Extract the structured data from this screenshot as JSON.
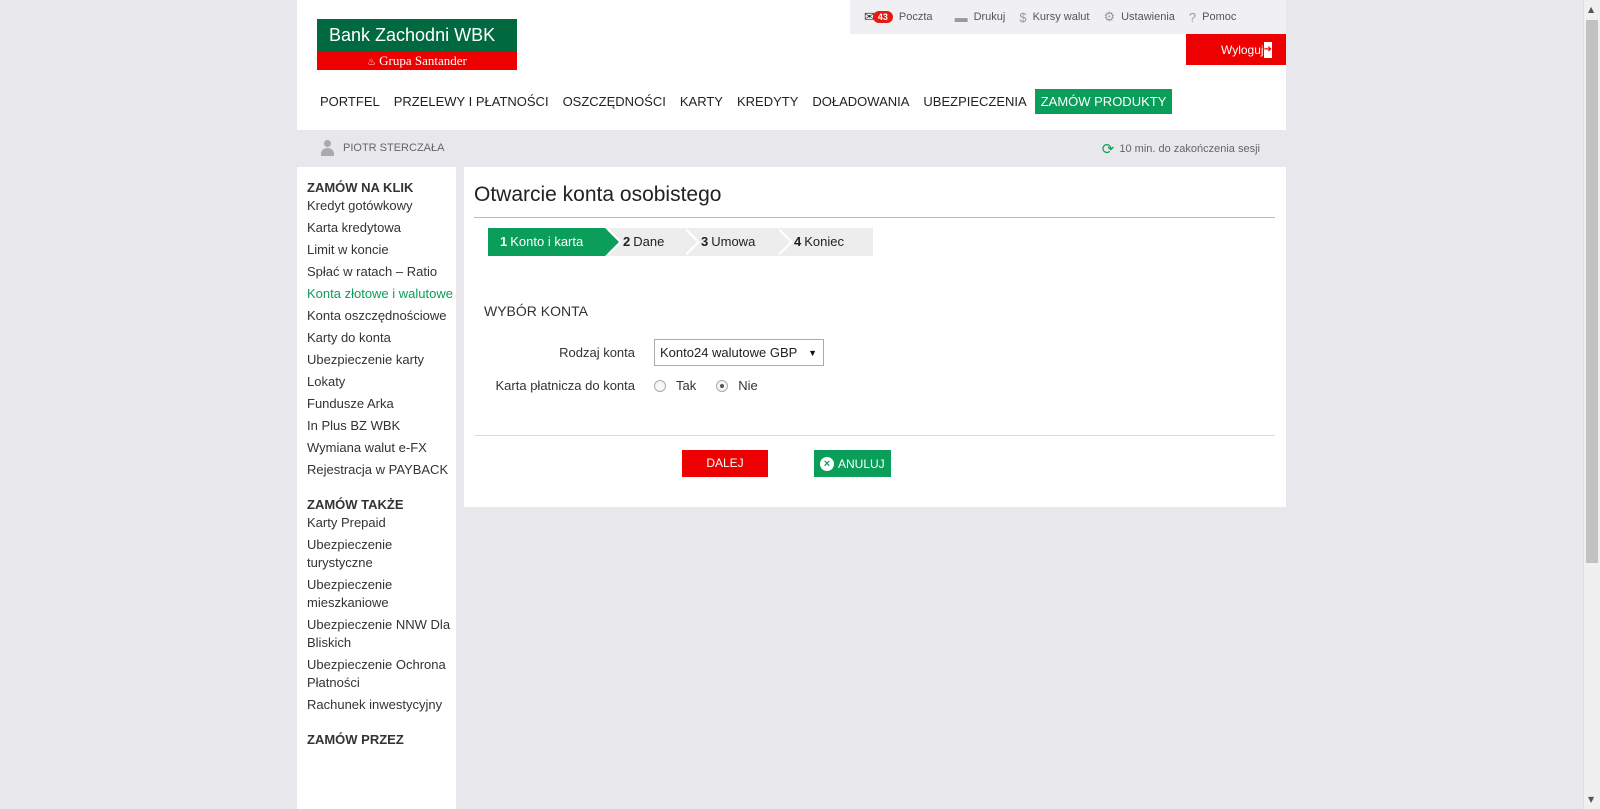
{
  "logo": {
    "line1": "Bank Zachodni WBK",
    "line2": "Grupa Santander"
  },
  "toplinks": {
    "mail_count": "43",
    "mail_label": "Poczta",
    "print_label": "Drukuj",
    "rates_label": "Kursy walut",
    "settings_label": "Ustawienia",
    "help_label": "Pomoc"
  },
  "logout_label": "Wyloguj",
  "nav": {
    "items": [
      "PORTFEL",
      "PRZELEWY I PŁATNOŚCI",
      "OSZCZĘDNOŚCI",
      "KARTY",
      "KREDYTY",
      "DOŁADOWANIA",
      "UBEZPIECZENIA",
      "ZAMÓW PRODUKTY"
    ]
  },
  "user": {
    "name": "PIOTR STERCZAŁA",
    "session": "10 min. do zakończenia sesji"
  },
  "sidebar": {
    "section1": "ZAMÓW NA KLIK",
    "items1": [
      "Kredyt gotówkowy",
      "Karta kredytowa",
      "Limit w koncie",
      "Spłać w ratach – Ratio",
      "Konta złotowe i walutowe",
      "Konta oszczędnościowe",
      "Karty do konta",
      "Ubezpieczenie karty",
      "Lokaty",
      "Fundusze Arka",
      "In Plus BZ WBK",
      "Wymiana walut e-FX",
      "Rejestracja w PAYBACK"
    ],
    "section2": "ZAMÓW TAKŻE",
    "items2": [
      "Karty Prepaid",
      "Ubezpieczenie turystyczne",
      "Ubezpieczenie mieszkaniowe",
      "Ubezpieczenie NNW Dla Bliskich",
      "Ubezpieczenie Ochrona Płatności",
      "Rachunek inwestycyjny"
    ],
    "section3": "ZAMÓW PRZEZ"
  },
  "main": {
    "title": "Otwarcie konta osobistego",
    "steps": [
      {
        "num": "1",
        "label": "Konto i karta"
      },
      {
        "num": "2",
        "label": "Dane"
      },
      {
        "num": "3",
        "label": "Umowa"
      },
      {
        "num": "4",
        "label": "Koniec"
      }
    ],
    "section_title": "WYBÓR KONTA",
    "account_type_label": "Rodzaj konta",
    "account_type_value": "Konto24 walutowe GBP",
    "card_label": "Karta płatnicza do konta",
    "radio_yes": "Tak",
    "radio_no": "Nie",
    "next_label": "DALEJ",
    "cancel_label": "ANULUJ"
  },
  "colors": {
    "green": "#0a9e5a",
    "red": "#ec0000",
    "dark_green": "#006940"
  }
}
